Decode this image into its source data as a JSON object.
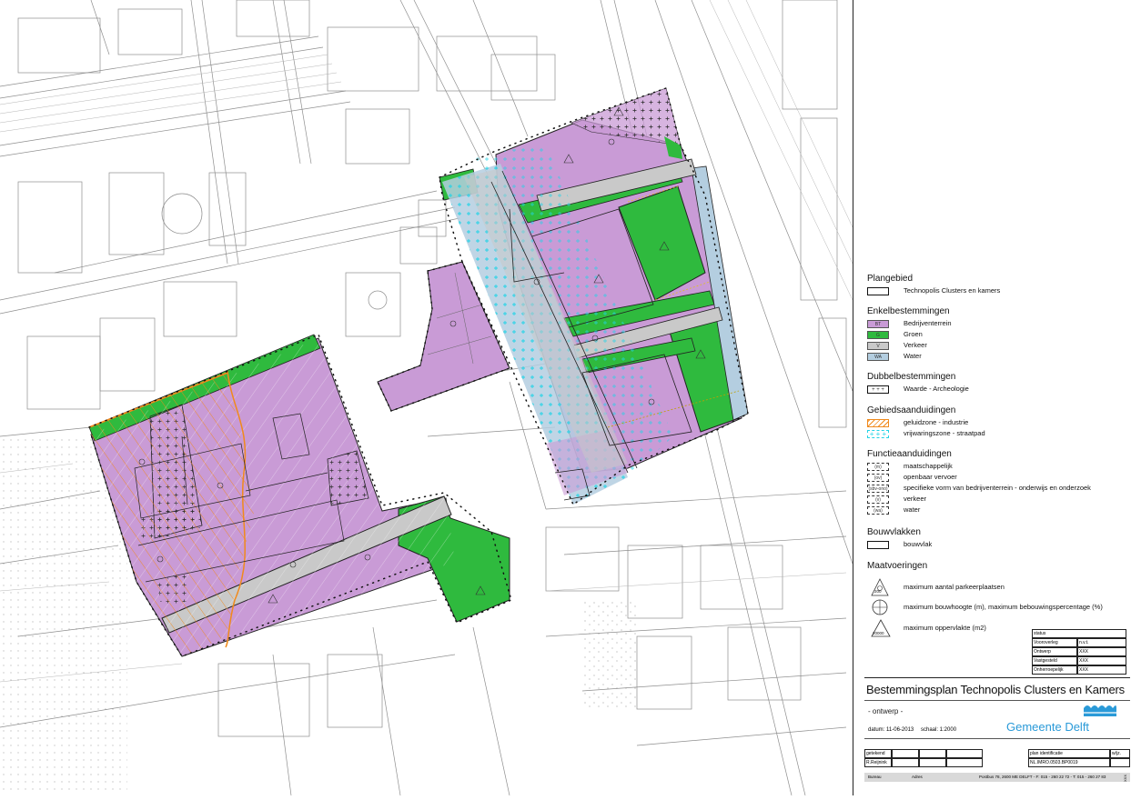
{
  "colors": {
    "bedrijventerrein": "#c99bd6",
    "groen": "#2fba3e",
    "verkeer": "#c9c9c9",
    "water": "#b4cee0",
    "geluidzone": "#f08a1c",
    "vrijwaringszone": "#22d3e6"
  },
  "legend": {
    "plangebied": {
      "heading": "Plangebied",
      "items": [
        {
          "label": "Technopolis Clusters en kamers"
        }
      ]
    },
    "enkelbestemmingen": {
      "heading": "Enkelbestemmingen",
      "items": [
        {
          "code": "BT",
          "label": "Bedrijventerrein"
        },
        {
          "code": "G",
          "label": "Groen"
        },
        {
          "code": "V",
          "label": "Verkeer"
        },
        {
          "code": "WA",
          "label": "Water"
        }
      ]
    },
    "dubbelbestemmingen": {
      "heading": "Dubbelbestemmingen",
      "items": [
        {
          "label": "Waarde - Archeologie"
        }
      ]
    },
    "gebiedsaanduidingen": {
      "heading": "Gebiedsaanduidingen",
      "items": [
        {
          "label": "geluidzone - industrie"
        },
        {
          "label": "vrijwaringszone - straatpad"
        }
      ]
    },
    "functieaanduidingen": {
      "heading": "Functieaanduidingen",
      "items": [
        {
          "code": "(m)",
          "label": "maatschappelijk"
        },
        {
          "code": "(ov)",
          "label": "openbaar vervoer"
        },
        {
          "code": "(sbv-ono)",
          "label": "specifieke vorm van bedrijventerrein - onderwijs en onderzoek"
        },
        {
          "code": "(v)",
          "label": "verkeer"
        },
        {
          "code": "(wa)",
          "label": "water"
        }
      ]
    },
    "bouwvlakken": {
      "heading": "Bouwvlakken",
      "items": [
        {
          "label": "bouwvlak"
        }
      ]
    },
    "maatvoeringen": {
      "heading": "Maatvoeringen",
      "items": [
        {
          "symbol": "200",
          "label": "maximum aantal parkeerplaatsen"
        },
        {
          "symbol": "",
          "label": "maximum bouwhoogte (m), maximum bebouwingspercentage (%)"
        },
        {
          "symbol": "20000",
          "label": "maximum oppervlakte (m2)"
        }
      ]
    }
  },
  "status_table": [
    {
      "k": "status",
      "v": ""
    },
    {
      "k": "Vooroverleg",
      "v": "n.v.t."
    },
    {
      "k": "Ontwerp",
      "v": "XXX"
    },
    {
      "k": "Vastgesteld",
      "v": "XXX"
    },
    {
      "k": "Onherroepelijk",
      "v": "XXX"
    }
  ],
  "title_block": {
    "plan_title": "Bestemmingsplan Technopolis Clusters en Kamers",
    "phase": "- ontwerp -",
    "date": "datum: 11-06-2013",
    "scale": "schaal: 1:2000",
    "municipality": "Gemeente Delft",
    "drawn_label": "getekend",
    "drawn_name": "R.Reijnink",
    "plan_id_label": "plan identificatie",
    "plan_id": "NL.IMRO.0503.BP0019",
    "wijz_label": "w/jz.",
    "footer_left": "Bureau",
    "footer_mid": "Adres",
    "footer_right": "Postbus 78, 2600 ME DELFT - F: 015 - 260 22 72 - T: 015 - 260 27 83",
    "side_code": "XXX"
  }
}
